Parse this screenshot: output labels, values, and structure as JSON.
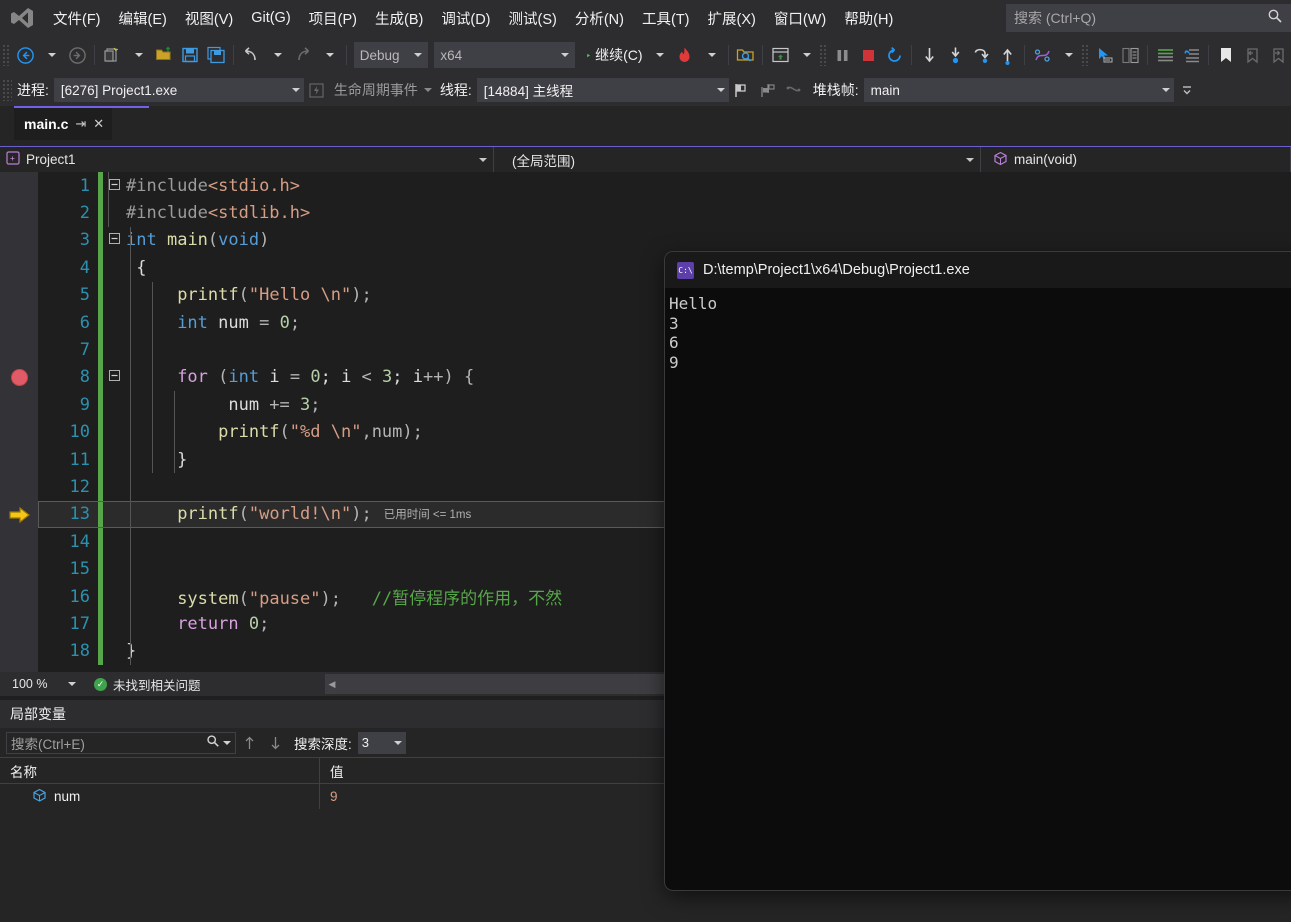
{
  "app": {
    "title": "Visual Studio",
    "logo_icon": "visual-studio-logo"
  },
  "menu": {
    "items": [
      {
        "label": "文件(F)",
        "name": "file"
      },
      {
        "label": "编辑(E)",
        "name": "edit"
      },
      {
        "label": "视图(V)",
        "name": "view"
      },
      {
        "label": "Git(G)",
        "name": "git"
      },
      {
        "label": "项目(P)",
        "name": "project"
      },
      {
        "label": "生成(B)",
        "name": "build"
      },
      {
        "label": "调试(D)",
        "name": "debug"
      },
      {
        "label": "测试(S)",
        "name": "test"
      },
      {
        "label": "分析(N)",
        "name": "analyze"
      },
      {
        "label": "工具(T)",
        "name": "tools"
      },
      {
        "label": "扩展(X)",
        "name": "extensions"
      },
      {
        "label": "窗口(W)",
        "name": "window"
      },
      {
        "label": "帮助(H)",
        "name": "help"
      }
    ],
    "search_placeholder": "搜索 (Ctrl+Q)",
    "search_icon": "search-icon"
  },
  "toolbar": {
    "back_icon": "navigate-back-icon",
    "forward_icon": "navigate-forward-icon",
    "new_item_icon": "new-item-icon",
    "open_file_icon": "open-file-icon",
    "save_icon": "save-icon",
    "save_all_icon": "save-all-icon",
    "undo_icon": "undo-icon",
    "redo_icon": "redo-icon",
    "configuration": "Debug",
    "platform": "x64",
    "continue_label": "继续(C)",
    "continue_icon": "play-icon",
    "hot_reload_icon": "hot-reload-icon",
    "attach_icon": "attach-to-process-icon",
    "window_icon": "window-layout-icon",
    "break_all_icon": "pause-icon",
    "stop_icon": "stop-icon",
    "restart_icon": "restart-icon",
    "step_into_icon": "step-into-icon",
    "step_over_icon": "step-over-icon",
    "step_out_icon": "step-out-icon",
    "show_next_icon": "show-next-statement-icon",
    "threads_icon": "threads-icon",
    "pointer_icon": "pointer-icon",
    "compare_icon": "compare-icon",
    "comment_icon": "comment-icon",
    "uncomment_icon": "uncomment-icon",
    "bookmark_icon": "bookmark-icon",
    "prev_bookmark_icon": "previous-bookmark-icon",
    "next_bookmark_icon": "next-bookmark-icon",
    "overflow_icon": "toolbar-overflow-icon"
  },
  "debug_bar": {
    "process_label": "进程:",
    "process_value": "[6276] Project1.exe",
    "lifecycle_label": "生命周期事件",
    "lifecycle_icon": "lifecycle-events-icon",
    "thread_label": "线程:",
    "thread_value": "[14884] 主线程",
    "flag_icon": "flag-icon",
    "flag_all_icon": "flag-all-icon",
    "unflag_icon": "unflag-icon",
    "stackframe_label": "堆栈帧:",
    "stackframe_value": "main",
    "overflow_icon": "toolbar-overflow-icon"
  },
  "tab": {
    "title": "main.c",
    "pin_icon": "pin-icon",
    "close_icon": "close-icon"
  },
  "navbar": {
    "project_icon": "project-icon",
    "project": "Project1",
    "scope": "(全局范围)",
    "member_icon": "method-icon",
    "member": "main(void)"
  },
  "editor": {
    "breakpoint_icon": "breakpoint-icon",
    "breakpoint_line": 8,
    "current_line": 13,
    "current_line_icon": "execution-pointer-icon",
    "elapsed_label": "已用时间 <= 1ms",
    "lines": [
      {
        "n": 1,
        "fold": "-",
        "tokens": [
          {
            "t": "#include",
            "c": "pp"
          },
          {
            "t": "<stdio.h>",
            "c": "hdr"
          }
        ]
      },
      {
        "n": 2,
        "fold": "",
        "tokens": [
          {
            "t": "#include",
            "c": "pp"
          },
          {
            "t": "<stdlib.h>",
            "c": "hdr"
          }
        ]
      },
      {
        "n": 3,
        "fold": "-",
        "tokens": [
          {
            "t": "int",
            "c": "k"
          },
          {
            "t": " ",
            "c": "pl"
          },
          {
            "t": "main",
            "c": "fn"
          },
          {
            "t": "(",
            "c": "op"
          },
          {
            "t": "void",
            "c": "k"
          },
          {
            "t": ")",
            "c": "op"
          }
        ]
      },
      {
        "n": 4,
        "fold": "",
        "tokens": [
          {
            "t": " {",
            "c": "pl"
          }
        ]
      },
      {
        "n": 5,
        "fold": "",
        "tokens": [
          {
            "t": "     ",
            "c": "pl"
          },
          {
            "t": "printf",
            "c": "fn"
          },
          {
            "t": "(",
            "c": "op"
          },
          {
            "t": "\"Hello \\n\"",
            "c": "str"
          },
          {
            "t": ");",
            "c": "op"
          }
        ]
      },
      {
        "n": 6,
        "fold": "",
        "tokens": [
          {
            "t": "     ",
            "c": "pl"
          },
          {
            "t": "int",
            "c": "k"
          },
          {
            "t": " num ",
            "c": "pl"
          },
          {
            "t": "=",
            "c": "op"
          },
          {
            "t": " ",
            "c": "pl"
          },
          {
            "t": "0",
            "c": "num"
          },
          {
            "t": ";",
            "c": "op"
          }
        ]
      },
      {
        "n": 7,
        "fold": "",
        "tokens": []
      },
      {
        "n": 8,
        "fold": "-",
        "tokens": [
          {
            "t": "     ",
            "c": "pl"
          },
          {
            "t": "for",
            "c": "kc"
          },
          {
            "t": " ",
            "c": "pl"
          },
          {
            "t": "(",
            "c": "op"
          },
          {
            "t": "int",
            "c": "k"
          },
          {
            "t": " i ",
            "c": "pl"
          },
          {
            "t": "=",
            "c": "op"
          },
          {
            "t": " ",
            "c": "pl"
          },
          {
            "t": "0",
            "c": "num"
          },
          {
            "t": "; i ",
            "c": "pl"
          },
          {
            "t": "<",
            "c": "op"
          },
          {
            "t": " ",
            "c": "pl"
          },
          {
            "t": "3",
            "c": "num"
          },
          {
            "t": "; i",
            "c": "pl"
          },
          {
            "t": "++) {",
            "c": "op"
          }
        ]
      },
      {
        "n": 9,
        "fold": "",
        "tokens": [
          {
            "t": "          num ",
            "c": "pl"
          },
          {
            "t": "+=",
            "c": "op"
          },
          {
            "t": " ",
            "c": "pl"
          },
          {
            "t": "3",
            "c": "num"
          },
          {
            "t": ";",
            "c": "op"
          }
        ]
      },
      {
        "n": 10,
        "fold": "",
        "tokens": [
          {
            "t": "         ",
            "c": "pl"
          },
          {
            "t": "printf",
            "c": "fn"
          },
          {
            "t": "(",
            "c": "op"
          },
          {
            "t": "\"%d \\n\"",
            "c": "str"
          },
          {
            "t": ",num);",
            "c": "op"
          }
        ]
      },
      {
        "n": 11,
        "fold": "",
        "tokens": [
          {
            "t": "     }",
            "c": "pl"
          }
        ]
      },
      {
        "n": 12,
        "fold": "",
        "tokens": []
      },
      {
        "n": 13,
        "fold": "",
        "tokens": [
          {
            "t": "     ",
            "c": "pl"
          },
          {
            "t": "printf",
            "c": "fn"
          },
          {
            "t": "(",
            "c": "op"
          },
          {
            "t": "\"world!\\n\"",
            "c": "str"
          },
          {
            "t": ");",
            "c": "op"
          }
        ]
      },
      {
        "n": 14,
        "fold": "",
        "tokens": []
      },
      {
        "n": 15,
        "fold": "",
        "tokens": []
      },
      {
        "n": 16,
        "fold": "",
        "tokens": [
          {
            "t": "     ",
            "c": "pl"
          },
          {
            "t": "system",
            "c": "fn"
          },
          {
            "t": "(",
            "c": "op"
          },
          {
            "t": "\"pause\"",
            "c": "str"
          },
          {
            "t": ");   ",
            "c": "op"
          },
          {
            "t": "//暂停程序的作用，不然",
            "c": "cm"
          }
        ]
      },
      {
        "n": 17,
        "fold": "",
        "tokens": [
          {
            "t": "     ",
            "c": "pl"
          },
          {
            "t": "return",
            "c": "kc"
          },
          {
            "t": " ",
            "c": "pl"
          },
          {
            "t": "0",
            "c": "num"
          },
          {
            "t": ";",
            "c": "op"
          }
        ]
      },
      {
        "n": 18,
        "fold": "",
        "tokens": [
          {
            "t": "}",
            "c": "pl"
          }
        ]
      }
    ]
  },
  "status": {
    "zoom": "100 %",
    "problems_icon": "check-circle-icon",
    "problems_text": "未找到相关问题",
    "scroll_left_icon": "scroll-left-icon"
  },
  "locals": {
    "title": "局部变量",
    "search_placeholder": "搜索(Ctrl+E)",
    "search_icon": "search-icon",
    "prev_icon": "search-prev-icon",
    "next_icon": "search-next-icon",
    "depth_label": "搜索深度:",
    "depth_value": "3",
    "columns": [
      "名称",
      "值"
    ],
    "rows": [
      {
        "icon": "variable-icon",
        "name": "num",
        "value": "9"
      }
    ]
  },
  "console": {
    "icon": "console-app-icon",
    "path": "D:\\temp\\Project1\\x64\\Debug\\Project1.exe",
    "output": [
      "Hello",
      "3",
      "6",
      "9"
    ]
  },
  "colors": {
    "accent_purple": "#7160e8",
    "menu_bg": "#2d2d30",
    "editor_bg": "#1e1e1e",
    "changebar_green": "#57a64a",
    "breakpoint_red": "#e05b67",
    "exec_arrow_yellow": "#f5c518",
    "play_green": "#4ec94e",
    "stop_red": "#d13438"
  }
}
